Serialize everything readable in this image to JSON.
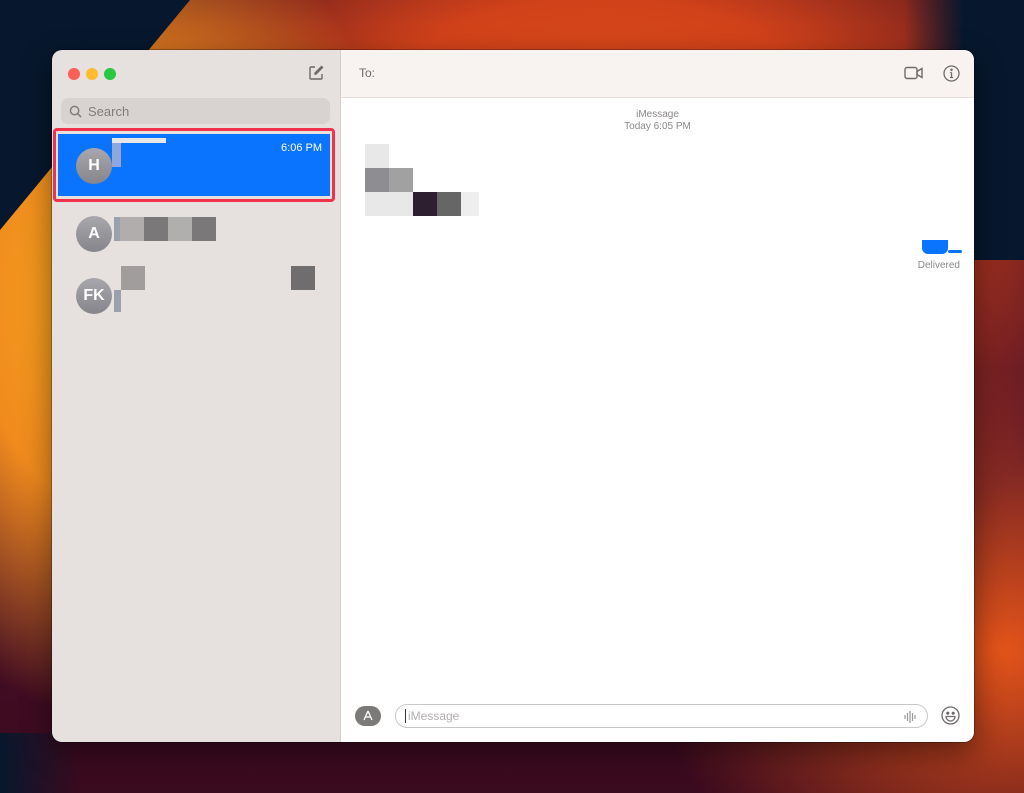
{
  "window": {
    "traffic_lights": [
      "close",
      "minimize",
      "zoom"
    ],
    "compose_icon": "compose-icon"
  },
  "sidebar": {
    "search": {
      "placeholder": "Search",
      "icon": "search-icon"
    },
    "conversations": [
      {
        "initials": "H",
        "name": "",
        "time": "6:06 PM",
        "selected": true,
        "redacted": true
      },
      {
        "initials": "A",
        "name": "",
        "time": "",
        "selected": false,
        "redacted": true
      },
      {
        "initials": "FK",
        "name": "",
        "time": "",
        "selected": false,
        "redacted": true
      }
    ]
  },
  "main": {
    "to_label": "To:",
    "header_icons": [
      "video-icon",
      "info-icon"
    ],
    "service": "iMessage",
    "timestamp": "Today 6:05 PM",
    "status": "Delivered",
    "composer": {
      "placeholder": "iMessage",
      "apps_icon": "app-store-icon",
      "audio_icon": "waveform-icon",
      "emoji_icon": "emoji-icon"
    }
  },
  "colors": {
    "accent": "#0a74ff",
    "highlight_border": "#f0334a",
    "sidebar_bg": "#e6e1df"
  }
}
